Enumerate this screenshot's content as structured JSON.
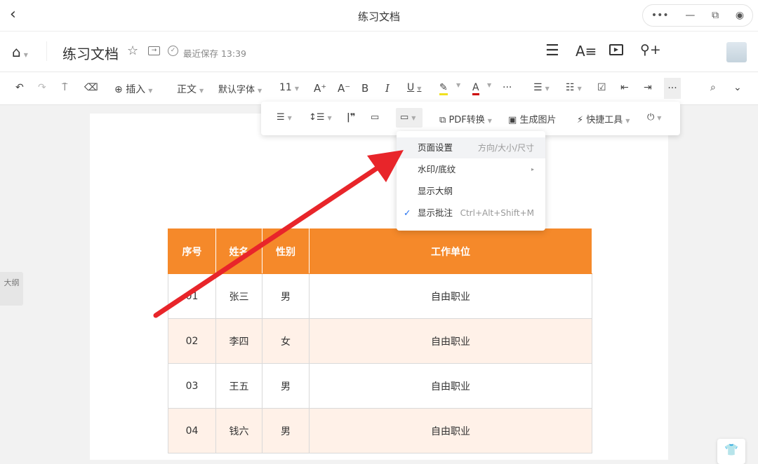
{
  "window": {
    "title": "练习文档"
  },
  "header": {
    "doc_title": "练习文档",
    "save_status": "最近保存 13:39",
    "share_label": "分享"
  },
  "toolbar": {
    "insert": "插入",
    "style": "正文",
    "font": "默认字体",
    "size": "11",
    "bold": "B",
    "italic": "I",
    "underline": "U",
    "more": "···"
  },
  "float_toolbar": {
    "pdf": "PDF转换",
    "image": "生成图片",
    "quick_tools": "快捷工具"
  },
  "menu": {
    "items": [
      {
        "label": "页面设置",
        "hint": "方向/大小/尺寸"
      },
      {
        "label": "水印/底纹",
        "hint": "▸"
      },
      {
        "label": "显示大纲",
        "hint": ""
      },
      {
        "label": "显示批注",
        "hint": "Ctrl+Alt+Shift+M",
        "checked": true
      }
    ]
  },
  "table": {
    "headers": [
      "序号",
      "姓名",
      "性别",
      "工作单位"
    ],
    "rows": [
      [
        "01",
        "张三",
        "男",
        "自由职业"
      ],
      [
        "02",
        "李四",
        "女",
        "自由职业"
      ],
      [
        "03",
        "王五",
        "男",
        "自由职业"
      ],
      [
        "04",
        "钱六",
        "男",
        "自由职业"
      ]
    ]
  },
  "sidebar": {
    "outline_label": "大纲"
  },
  "colors": {
    "accent": "#1f6ff0",
    "table_header": "#f5892a",
    "arrow": "#e8252a"
  }
}
